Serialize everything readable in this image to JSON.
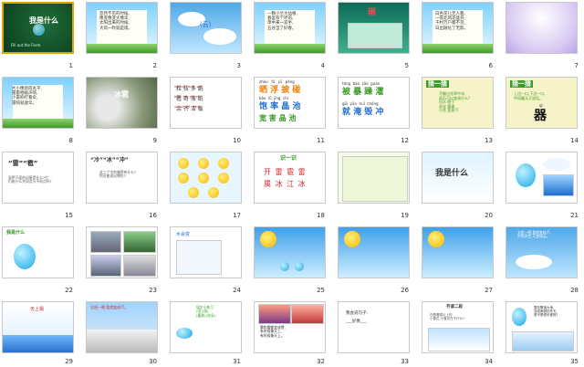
{
  "slides": [
    {
      "num": "1",
      "title": "我是什么",
      "sub": "Fill out the Form"
    },
    {
      "num": "2",
      "lines": "忽然不见的时候,\n像变像变大像伞,\n太阳出来的时候,\n大风一吹就是雨。"
    },
    {
      "num": "3",
      "text": "(云)"
    },
    {
      "num": "4",
      "lines": "一颗小兰大仙根,\n春里有个坏的,\n草中来一双手,\n五谷当了好春。"
    },
    {
      "num": "5",
      "text": "雨"
    },
    {
      "num": "6",
      "lines": "白色花儿无人栽,\n一夜北风花盛开,\n千村万户都不见,\n日出融化了无影。"
    },
    {
      "num": "7",
      "text": ""
    },
    {
      "num": "8",
      "lines": "大小像烧肉丸子,\n雷雷相碰声响,\n小雷响打看伞,\n雷响就收伞。"
    },
    {
      "num": "9",
      "text": "冰雹"
    },
    {
      "num": "10",
      "pinyin": "lì jiāng  duō  zhǐ\nbào  hé  yè  zhǐ\nyú  pì  jié  bǎn",
      "chars": "粒 弦 多 纸\n雹 奇 液 纸\n余 齐 洁 板"
    },
    {
      "num": "11",
      "pinyin": "zhòu   fú   pī   pěng",
      "row1": "晒 浮 披 碰",
      "pinyin2": "bǎo  lǜ  jīng  chí",
      "row2": "饱 率 晶 池",
      "row3": "宽 害 晶 池"
    },
    {
      "num": "12",
      "pinyin": "tóng  bào  zāo  guàn",
      "row1": "被 暴 躁 灌",
      "pinyin2": "gōi  yān  huǐ  chóng",
      "row2": "就 淹 毁 冲"
    },
    {
      "num": "13",
      "title": "猜一猜",
      "lines": "不翻过花草中冰,\n雨石可以变成什么?\n田水 晒干\n苗宝 露珠\n小花 变蒸汽"
    },
    {
      "num": "14",
      "title": "猜一猜",
      "lines": "上边一口,下边一口,\n中间露天又说话。",
      "qi": "qì",
      "big": "器"
    },
    {
      "num": "15",
      "title": "“雷”“雹”",
      "lines": "说明下面的词意是什么?它\n们有什么共同点与不同点吗?"
    },
    {
      "num": "16",
      "title": "“冷”“冰”“冲”",
      "lines": "这三个字的偏旁有什么?\n你还能说出哪些?"
    },
    {
      "num": "17",
      "text": "多音字小太阳"
    },
    {
      "num": "18",
      "title": "识一识",
      "cells": "开 雷 雹 雷\n属 冰 江 冰"
    },
    {
      "num": "19",
      "text": ""
    },
    {
      "num": "20",
      "text": "我是什么"
    },
    {
      "num": "21",
      "text": ""
    },
    {
      "num": "22",
      "text": "我是什么"
    },
    {
      "num": "23",
      "text": ""
    },
    {
      "num": "24",
      "text": "水会变"
    },
    {
      "num": "25",
      "text": ""
    },
    {
      "num": "26",
      "text": ""
    },
    {
      "num": "27",
      "text": ""
    },
    {
      "num": "28",
      "lines": "太阳一晒,我就变成汽,\n升到天空,又变成云。"
    },
    {
      "num": "29",
      "text": "天上飘"
    },
    {
      "num": "30",
      "text": "太阳一晒,我就变成汽。"
    },
    {
      "num": "31",
      "lines": "填空小练习\n(田)(苗)\n(露珠)(花朵)"
    },
    {
      "num": "32",
      "lines": "雾和霜都变成雪,\n有时候像天上,\n有时候像天上。"
    },
    {
      "num": "33",
      "lines": "我会说句子:\n___好像___"
    },
    {
      "num": "34",
      "title": "齐读二段",
      "lines": "在看看图片上的\n小雪花,小雪花在干什么?"
    },
    {
      "num": "35",
      "lines": "雪花飘落大地,\n变成美丽的冬天,\n是不是很可爱呢?"
    }
  ],
  "colors": {
    "selected": "#e0a300",
    "orange": "#f07d00",
    "green": "#3a9b26",
    "red": "#d22a2a",
    "blue": "#1f6fd0"
  }
}
